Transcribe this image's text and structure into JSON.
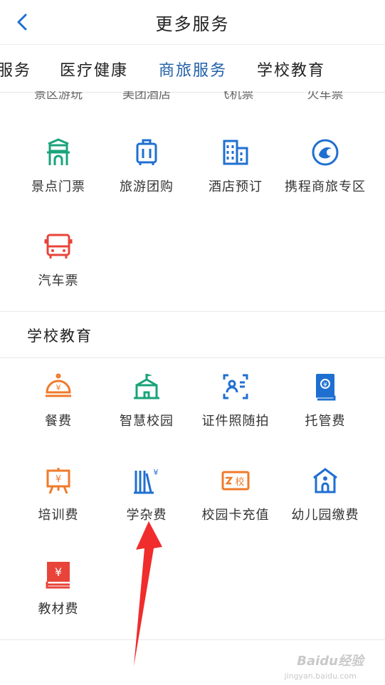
{
  "header": {
    "title": "更多服务"
  },
  "tabs": [
    "服务",
    "医疗健康",
    "商旅服务",
    "学校教育"
  ],
  "cut_row": [
    "景区游玩",
    "美团酒店",
    "飞机票",
    "火车票"
  ],
  "travel": {
    "items": [
      {
        "label": "景点门票",
        "icon": "gate-icon",
        "color": "#1aa37a"
      },
      {
        "label": "旅游团购",
        "icon": "luggage-icon",
        "color": "#1f6fd1"
      },
      {
        "label": "酒店预订",
        "icon": "hotel-building-icon",
        "color": "#1f6fd1"
      },
      {
        "label": "携程商旅专区",
        "icon": "ctrip-dolphin-icon",
        "color": "#1f6fd1"
      },
      {
        "label": "汽车票",
        "icon": "bus-icon",
        "color": "#e8443a"
      }
    ]
  },
  "school": {
    "title": "学校教育",
    "items": [
      {
        "label": "餐费",
        "icon": "meal-cover-icon",
        "color": "#f07a2a"
      },
      {
        "label": "智慧校园",
        "icon": "school-building-icon",
        "color": "#1aa37a"
      },
      {
        "label": "证件照随拍",
        "icon": "id-photo-icon",
        "color": "#1f6fd1"
      },
      {
        "label": "托管费",
        "icon": "fee-book-icon",
        "color": "#1f6fd1"
      },
      {
        "label": "培训费",
        "icon": "training-board-icon",
        "color": "#f07a2a"
      },
      {
        "label": "学杂费",
        "icon": "books-yuan-icon",
        "color": "#1f6fd1"
      },
      {
        "label": "校园卡充值",
        "icon": "campus-card-icon",
        "color": "#f07a2a"
      },
      {
        "label": "幼儿园缴费",
        "icon": "kindergarten-icon",
        "color": "#1f6fd1"
      },
      {
        "label": "教材费",
        "icon": "textbook-yuan-icon",
        "color": "#e8443a"
      }
    ]
  },
  "watermark": {
    "brand": "Baidu经验",
    "site": "jingyan.baidu.com"
  }
}
